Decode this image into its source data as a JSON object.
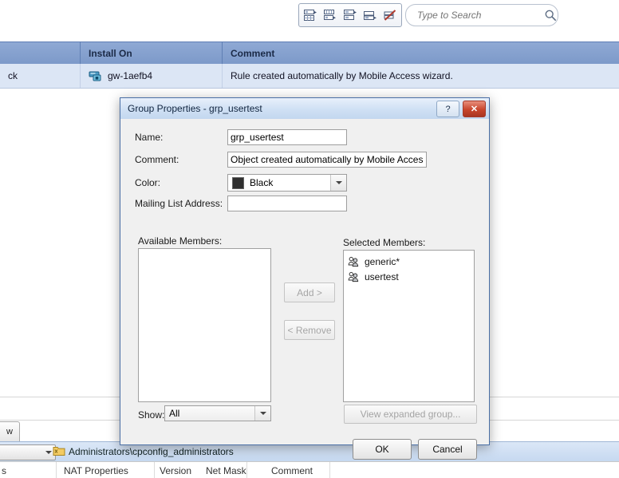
{
  "app": {
    "toolbar": {
      "tools": [
        {
          "name": "layout-columns-icon",
          "title": "Arrange columns"
        },
        {
          "name": "layout-grid-icon",
          "title": "Grid view"
        },
        {
          "name": "layout-rows-icon",
          "title": "Row view"
        },
        {
          "name": "layout-split-icon",
          "title": "Split view"
        },
        {
          "name": "clear-filter-icon",
          "title": "Clear filter"
        }
      ],
      "search_placeholder": "Type to Search",
      "search_value": ""
    },
    "rules_table": {
      "headers": [
        "",
        "Install On",
        "Comment"
      ],
      "rows": [
        {
          "action": "ck",
          "install_on": "gw-1aefb4",
          "comment": "Rule created automatically by Mobile Access wizard."
        }
      ]
    },
    "bottom": {
      "tab_label": "w",
      "status_text": "Administrators\\cpconfig_administrators",
      "combo_value": "",
      "column_headers": [
        "s",
        "NAT Properties",
        "Version",
        "Net Mask",
        "Comment"
      ]
    }
  },
  "dialog": {
    "title": "Group Properties - grp_usertest",
    "help_label": "?",
    "close_label": "✕",
    "fields": {
      "name_label": "Name:",
      "name_value": "grp_usertest",
      "comment_label": "Comment:",
      "comment_value": "Object created automatically by Mobile Access wizard",
      "color_label": "Color:",
      "color_value": "Black",
      "color_hex": "#303030",
      "mailing_label": "Mailing List Address:",
      "mailing_value": ""
    },
    "members": {
      "available_label": "Available Members:",
      "available_items": [],
      "selected_label": "Selected Members:",
      "selected_items": [
        {
          "label": "generic*",
          "icon": "users-group-icon"
        },
        {
          "label": "usertest",
          "icon": "users-group-icon"
        }
      ],
      "add_label": "Add >",
      "remove_label": "< Remove",
      "show_label": "Show:",
      "show_value": "All",
      "view_expanded_label": "View expanded group..."
    },
    "actions": {
      "ok_label": "OK",
      "cancel_label": "Cancel"
    }
  }
}
